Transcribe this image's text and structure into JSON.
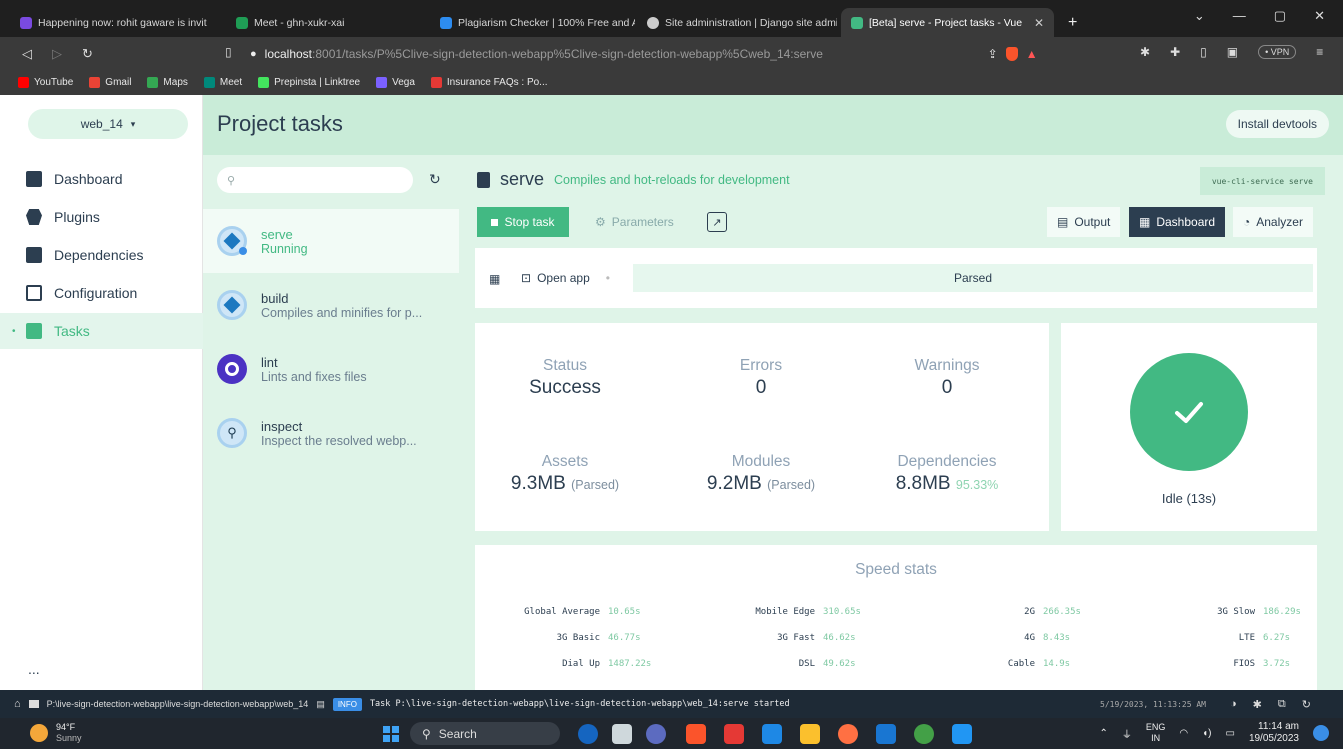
{
  "browser": {
    "tabs": [
      {
        "title": "Happening now: rohit gaware is invit",
        "color": "#7a4ae0"
      },
      {
        "title": "Meet - ghn-xukr-xai",
        "color": "#1f9d55"
      },
      {
        "title": "Plagiarism Checker | 100% Free and A",
        "color": "#2d8cf0"
      },
      {
        "title": "Site administration | Django site admi",
        "color": "#cccccc"
      },
      {
        "title": "[Beta] serve - Project tasks - Vue",
        "color": "#42b983"
      }
    ],
    "url_host": "localhost",
    "url_rest": ":8001/tasks/P%5Clive-sign-detection-webapp%5Clive-sign-detection-webapp%5Cweb_14:serve",
    "vpn_label": "• VPN",
    "bookmarks": [
      {
        "label": "YouTube",
        "color": "#ff0000"
      },
      {
        "label": "Gmail",
        "color": "#ea4335"
      },
      {
        "label": "Maps",
        "color": "#34a853"
      },
      {
        "label": "Meet",
        "color": "#00897b"
      },
      {
        "label": "Prepinsta | Linktree",
        "color": "#43e55e"
      },
      {
        "label": "Vega",
        "color": "#7b61ff"
      },
      {
        "label": "Insurance FAQs : Po...",
        "color": "#e53935"
      }
    ]
  },
  "sidebar": {
    "project": "web_14",
    "items": [
      {
        "label": "Dashboard",
        "icon": "dashboard-icon"
      },
      {
        "label": "Plugins",
        "icon": "puzzle-icon"
      },
      {
        "label": "Dependencies",
        "icon": "book-icon"
      },
      {
        "label": "Configuration",
        "icon": "config-icon"
      },
      {
        "label": "Tasks",
        "icon": "tasks-icon"
      }
    ],
    "more": "..."
  },
  "header": {
    "title": "Project tasks",
    "install_devtools": "Install devtools"
  },
  "tasks": {
    "search_placeholder": "",
    "items": [
      {
        "name": "serve",
        "desc": "Running"
      },
      {
        "name": "build",
        "desc": "Compiles and minifies for p..."
      },
      {
        "name": "lint",
        "desc": "Lints and fixes files"
      },
      {
        "name": "inspect",
        "desc": "Inspect the resolved webp..."
      }
    ]
  },
  "detail": {
    "name": "serve",
    "desc": "Compiles and hot-reloads for development",
    "command": "vue-cli-service serve",
    "stop_task": "Stop task",
    "parameters": "Parameters",
    "views": {
      "output": "Output",
      "dashboard": "Dashboard",
      "analyzer": "Analyzer"
    },
    "open_app": "Open app",
    "parsed": "Parsed",
    "stats": {
      "status_label": "Status",
      "status_value": "Success",
      "errors_label": "Errors",
      "errors_value": "0",
      "warnings_label": "Warnings",
      "warnings_value": "0",
      "assets_label": "Assets",
      "assets_value": "9.3MB",
      "assets_note": "(Parsed)",
      "modules_label": "Modules",
      "modules_value": "9.2MB",
      "modules_note": "(Parsed)",
      "deps_label": "Dependencies",
      "deps_value": "8.8MB",
      "deps_note": "95.33%"
    },
    "idle": "Idle (13s)",
    "speed_title": "Speed stats",
    "speed": [
      {
        "k": "Global Average",
        "v": "10.65s"
      },
      {
        "k": "Mobile Edge",
        "v": "310.65s"
      },
      {
        "k": "2G",
        "v": "266.35s"
      },
      {
        "k": "3G Slow",
        "v": "186.29s"
      },
      {
        "k": "3G Basic",
        "v": "46.77s"
      },
      {
        "k": "3G Fast",
        "v": "46.62s"
      },
      {
        "k": "4G",
        "v": "8.43s"
      },
      {
        "k": "LTE",
        "v": "6.27s"
      },
      {
        "k": "Dial Up",
        "v": "1487.22s"
      },
      {
        "k": "DSL",
        "v": "49.62s"
      },
      {
        "k": "Cable",
        "v": "14.9s"
      },
      {
        "k": "FIOS",
        "v": "3.72s"
      }
    ]
  },
  "statusbar": {
    "path": "P:\\live-sign-detection-webapp\\live-sign-detection-webapp\\web_14",
    "badge": "INFO",
    "message": "Task P:\\live-sign-detection-webapp\\live-sign-detection-webapp\\web_14:serve started",
    "time": "5/19/2023, 11:13:25 AM"
  },
  "taskbar": {
    "temp": "94°F",
    "weather": "Sunny",
    "search": "Search",
    "lang1": "ENG",
    "lang2": "IN",
    "time": "11:14 am",
    "date": "19/05/2023"
  }
}
